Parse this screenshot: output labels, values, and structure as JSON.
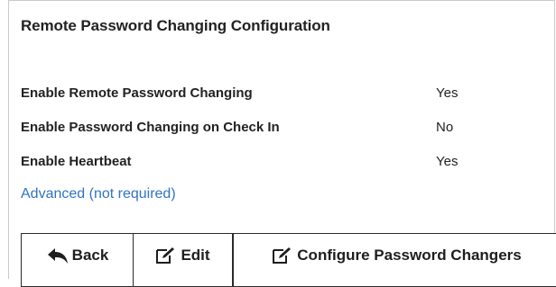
{
  "panel": {
    "title": "Remote Password Changing Configuration"
  },
  "settings": [
    {
      "label": "Enable Remote Password Changing",
      "value": "Yes"
    },
    {
      "label": "Enable Password Changing on Check In",
      "value": "No"
    },
    {
      "label": "Enable Heartbeat",
      "value": "Yes"
    }
  ],
  "advanced_link": "Advanced (not required)",
  "buttons": {
    "back": {
      "label": "Back",
      "icon": "back-arrow-icon"
    },
    "edit": {
      "label": "Edit",
      "icon": "edit-icon"
    },
    "configure": {
      "label": "Configure Password Changers",
      "icon": "edit-icon"
    }
  },
  "colors": {
    "link": "#2f73c4",
    "text": "#222222",
    "border": "#c9c9c9"
  }
}
